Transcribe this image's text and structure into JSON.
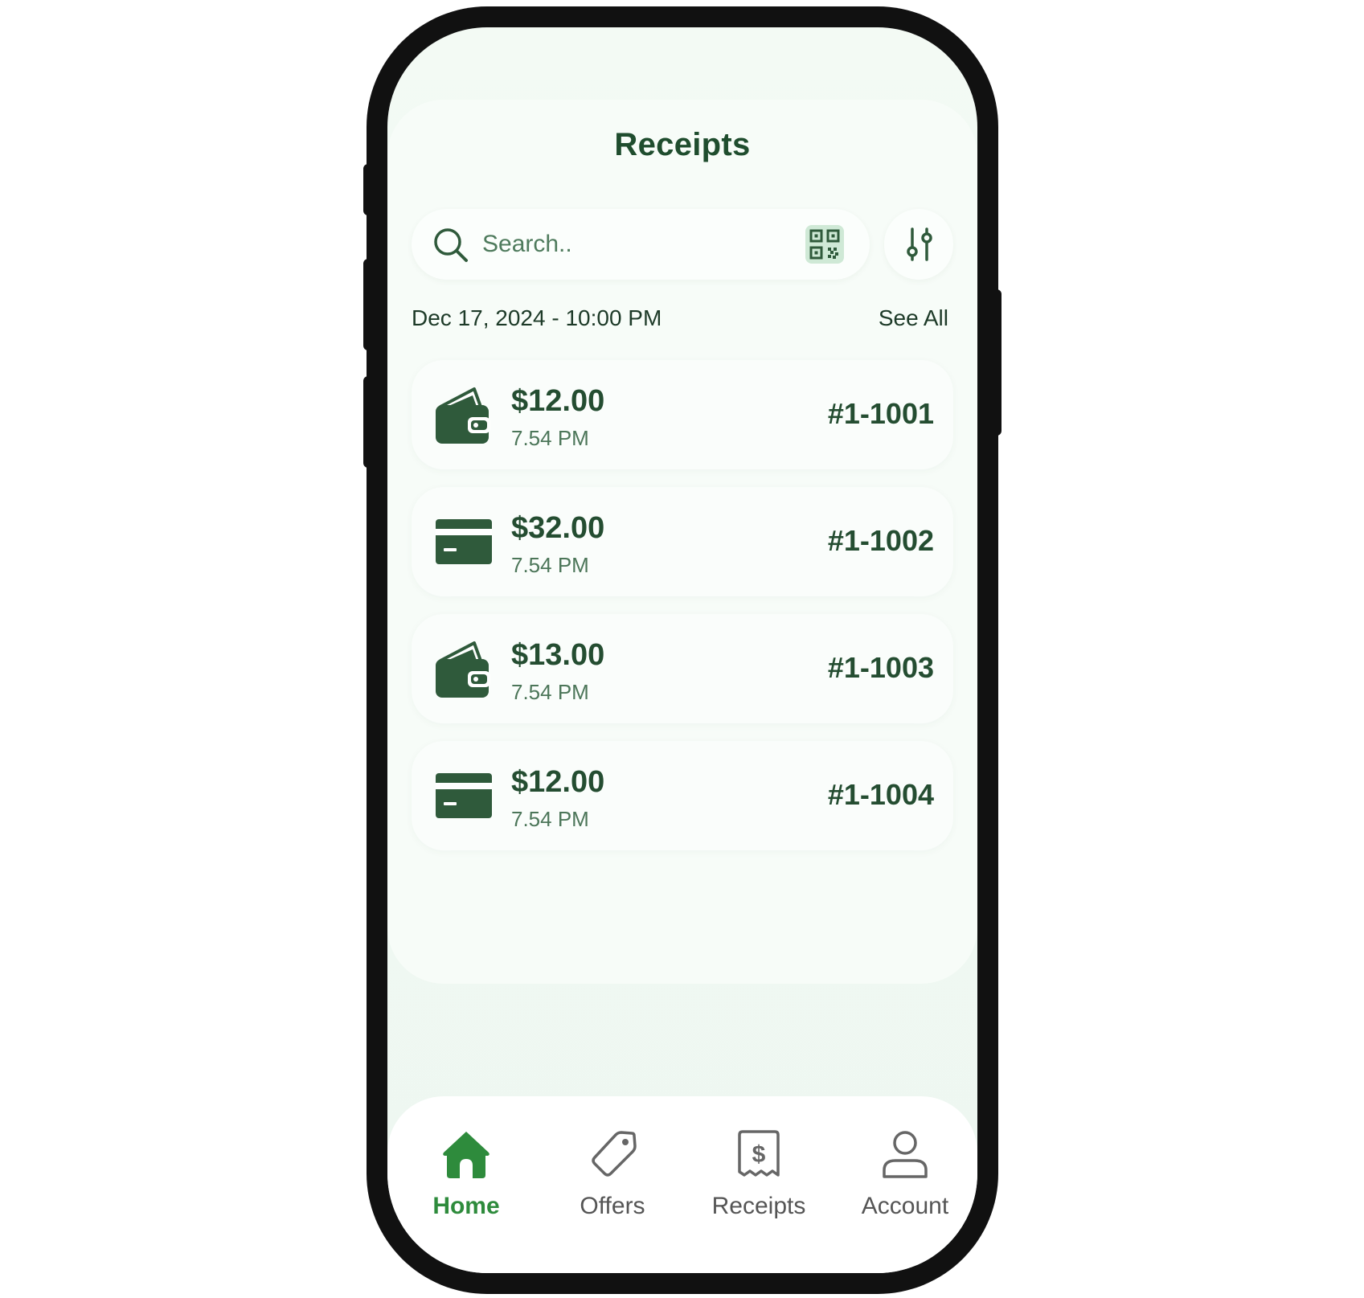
{
  "colors": {
    "accent": "#2e8b3c",
    "primary_text": "#244d31",
    "icon_dark": "#2f5a3b",
    "qr_background": "#cfe9d6",
    "inactive_nav": "#555555"
  },
  "header": {
    "title": "Receipts"
  },
  "search": {
    "placeholder": "Search..",
    "value": "",
    "search_icon": "search-icon",
    "qr_icon": "qr-code-icon",
    "filter_icon": "sliders-icon"
  },
  "list_header": {
    "date": "Dec 17, 2024 - 10:00 PM",
    "see_all": "See All"
  },
  "receipts": [
    {
      "icon": "wallet-icon",
      "amount": "$12.00",
      "time": "7.54 PM",
      "order_id": "#1-1001"
    },
    {
      "icon": "credit-card-icon",
      "amount": "$32.00",
      "time": "7.54 PM",
      "order_id": "#1-1002"
    },
    {
      "icon": "wallet-icon",
      "amount": "$13.00",
      "time": "7.54 PM",
      "order_id": "#1-1003"
    },
    {
      "icon": "credit-card-icon",
      "amount": "$12.00",
      "time": "7.54 PM",
      "order_id": "#1-1004"
    }
  ],
  "bottom_nav": {
    "items": [
      {
        "label": "Home",
        "icon": "home-icon",
        "active": true
      },
      {
        "label": "Offers",
        "icon": "tag-icon",
        "active": false
      },
      {
        "label": "Receipts",
        "icon": "receipt-icon",
        "active": false
      },
      {
        "label": "Account",
        "icon": "user-icon",
        "active": false
      }
    ]
  }
}
